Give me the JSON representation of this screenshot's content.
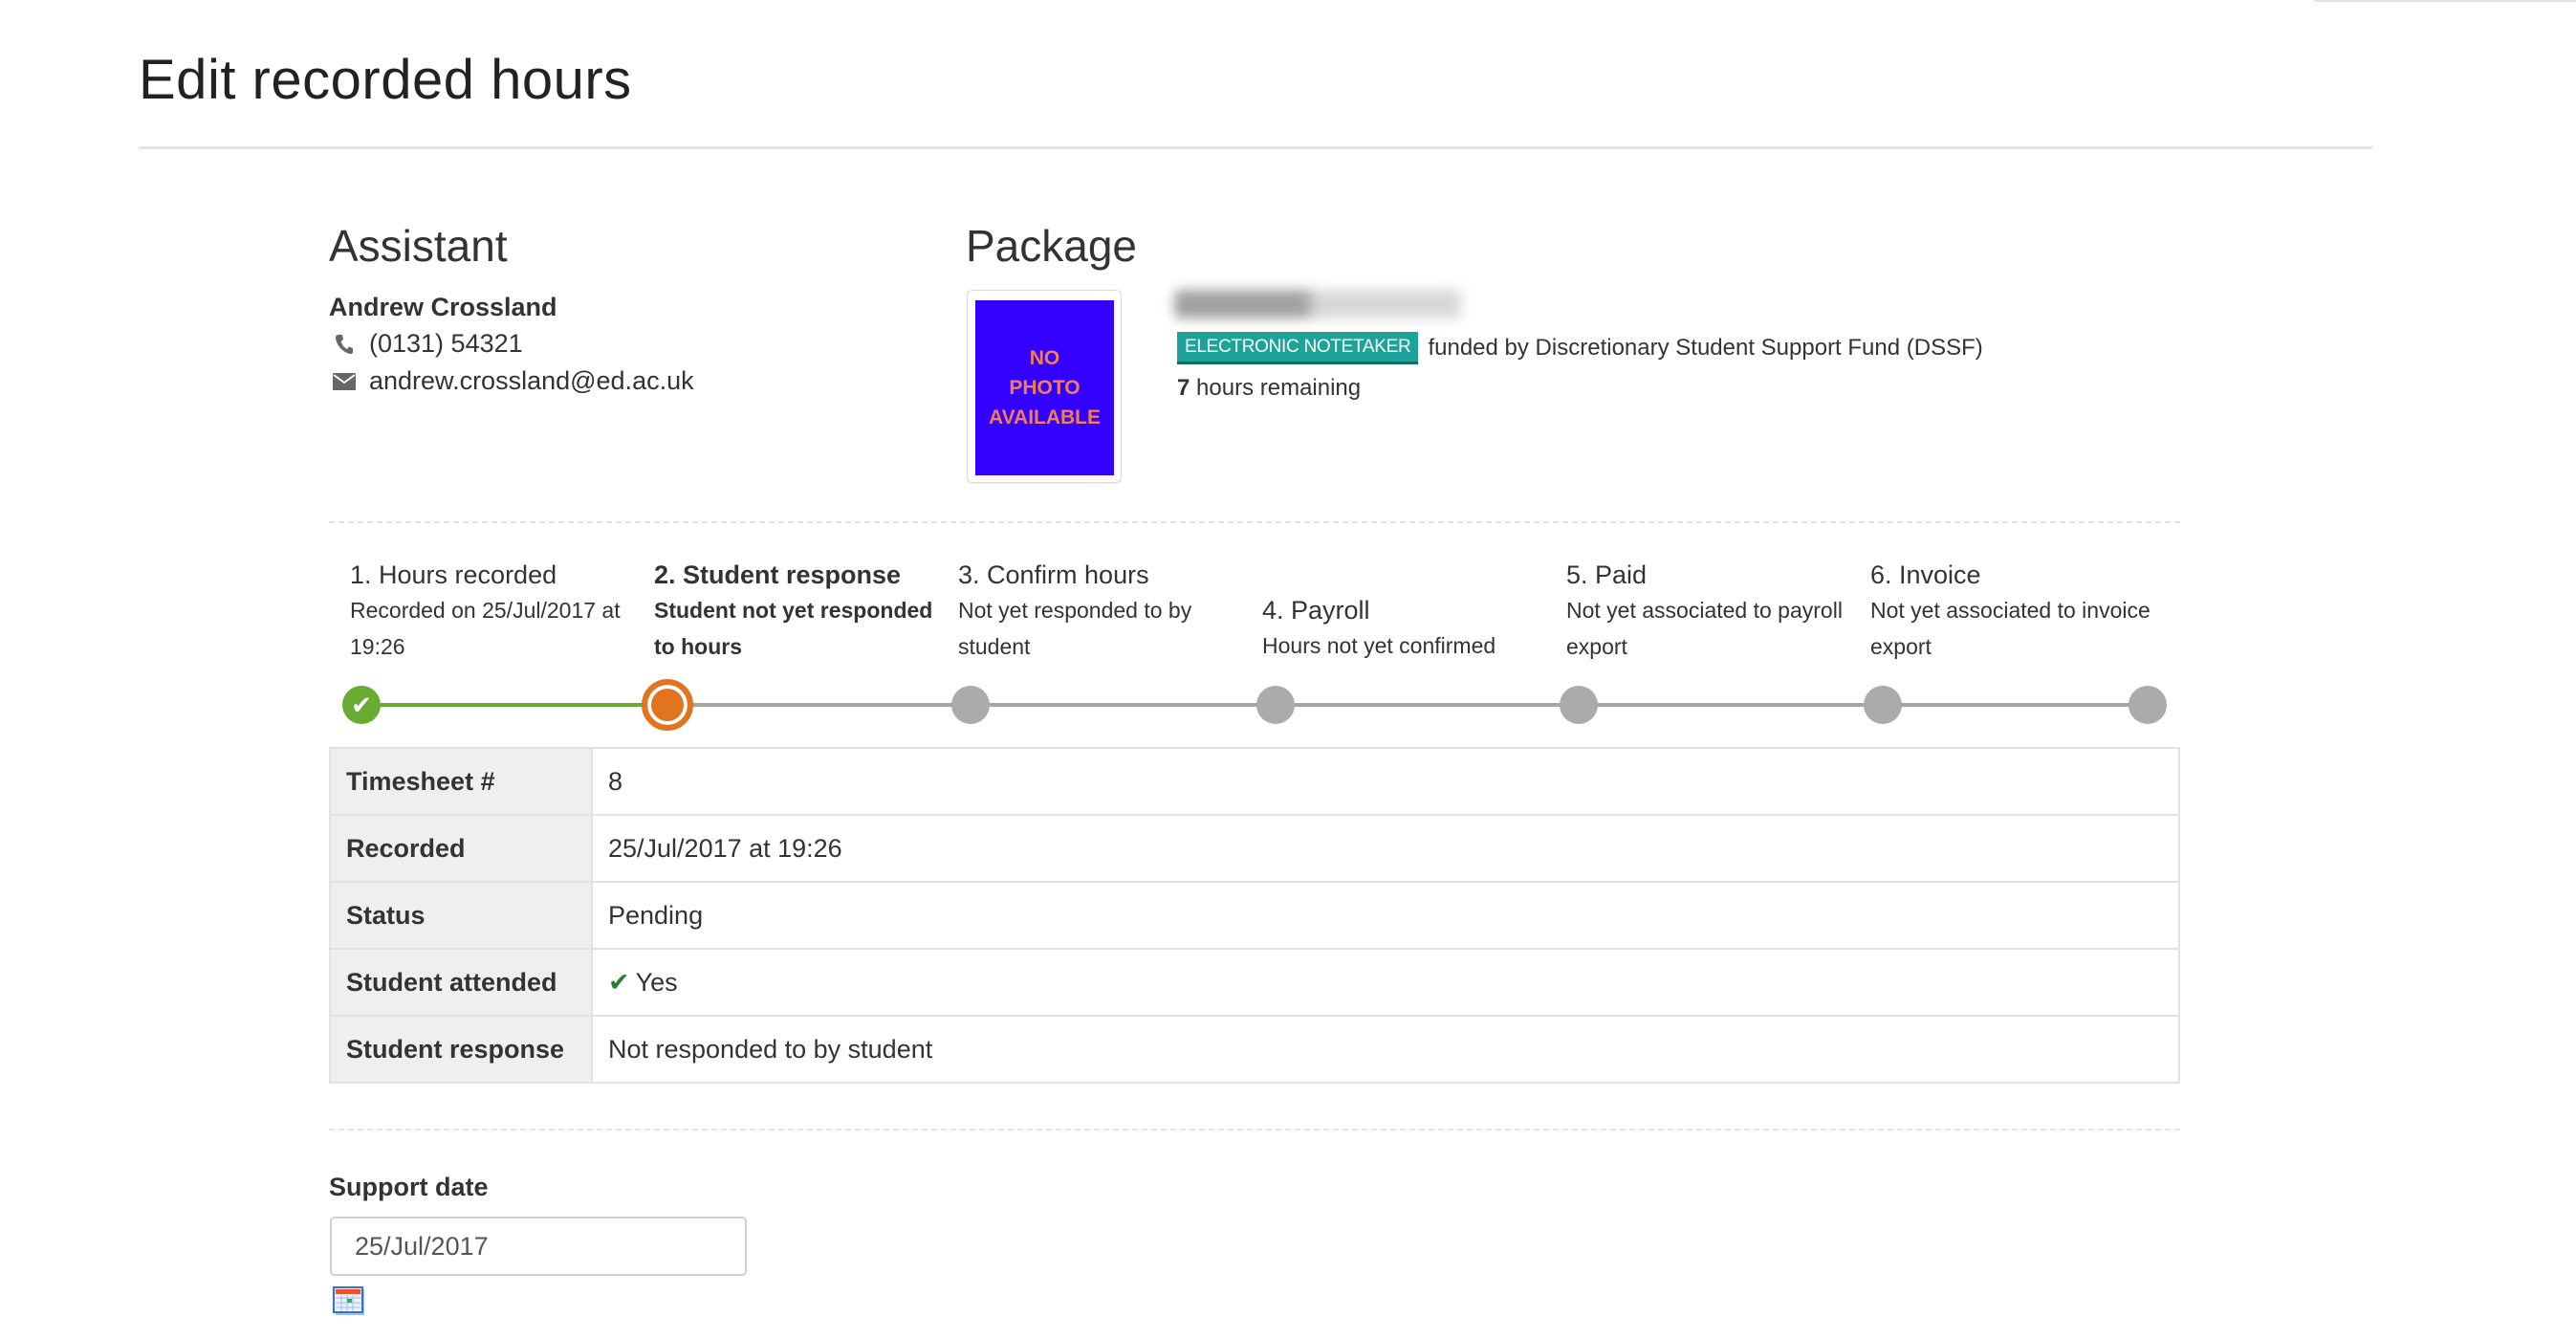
{
  "page": {
    "title": "Edit recorded hours"
  },
  "assistant": {
    "heading": "Assistant",
    "name": "Andrew Crossland",
    "phone": "(0131) 54321",
    "email": "andrew.crossland@ed.ac.uk",
    "phone_icon": "phone-icon",
    "email_icon": "envelope-icon"
  },
  "package": {
    "heading": "Package",
    "photo_placeholder": [
      "NO",
      "PHOTO",
      "AVAILABLE"
    ],
    "student_name_redacted": true,
    "badge": "ELECTRONIC NOTETAKER",
    "funding": "funded by Discretionary Student Support Fund (DSSF)",
    "hours_remaining_value": "7",
    "hours_remaining_label": "hours remaining",
    "colors": {
      "badge": "#1ea39a",
      "photo_bg": "#3300ff"
    }
  },
  "progress": {
    "steps": [
      {
        "title": "1. Hours recorded",
        "desc": "Recorded on 25/Jul/2017 at 19:26",
        "state": "done"
      },
      {
        "title": "2. Student response",
        "desc": "Student not yet responded to hours",
        "state": "active"
      },
      {
        "title": "3. Confirm hours",
        "desc": "Not yet responded to by student",
        "state": "todo"
      },
      {
        "title": "4. Payroll",
        "desc": "Hours not yet confirmed",
        "state": "todo"
      },
      {
        "title": "5. Paid",
        "desc": "Not yet associated to payroll export",
        "state": "todo"
      },
      {
        "title": "6. Invoice",
        "desc": "Not yet associated to invoice export",
        "state": "todo"
      }
    ],
    "colors": {
      "done": "#6aab33",
      "active": "#e2731f",
      "todo": "#ababab"
    }
  },
  "details": {
    "rows": [
      {
        "label": "Timesheet #",
        "value": "8"
      },
      {
        "label": "Recorded",
        "value": "25/Jul/2017 at 19:26"
      },
      {
        "label": "Status",
        "value": "Pending"
      },
      {
        "label": "Student attended",
        "value": "Yes",
        "icon": "check-icon"
      },
      {
        "label": "Student response",
        "value": "Not responded to by student"
      }
    ]
  },
  "form": {
    "support_date_label": "Support date",
    "support_date_value": "25/Jul/2017",
    "calendar_icon": "calendar-icon"
  }
}
